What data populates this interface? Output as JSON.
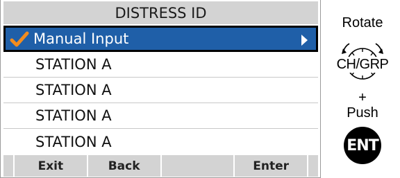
{
  "header": {
    "title": "DISTRESS ID"
  },
  "list": {
    "items": [
      {
        "label": "Manual Input",
        "selected": true
      },
      {
        "label": "STATION A",
        "selected": false
      },
      {
        "label": "STATION A",
        "selected": false
      },
      {
        "label": "STATION A",
        "selected": false
      },
      {
        "label": "STATION A",
        "selected": false
      }
    ]
  },
  "softkeys": [
    "Exit",
    "Back",
    "",
    "Enter"
  ],
  "controls": {
    "rotate_label": "Rotate",
    "knob_label": "CH/GRP",
    "plus_label": "+",
    "push_label": "Push",
    "ent_label": "ENT"
  },
  "colors": {
    "selection": "#1f5fa8",
    "check": "#f28c1e",
    "title_bar": "#d3d3d3"
  }
}
